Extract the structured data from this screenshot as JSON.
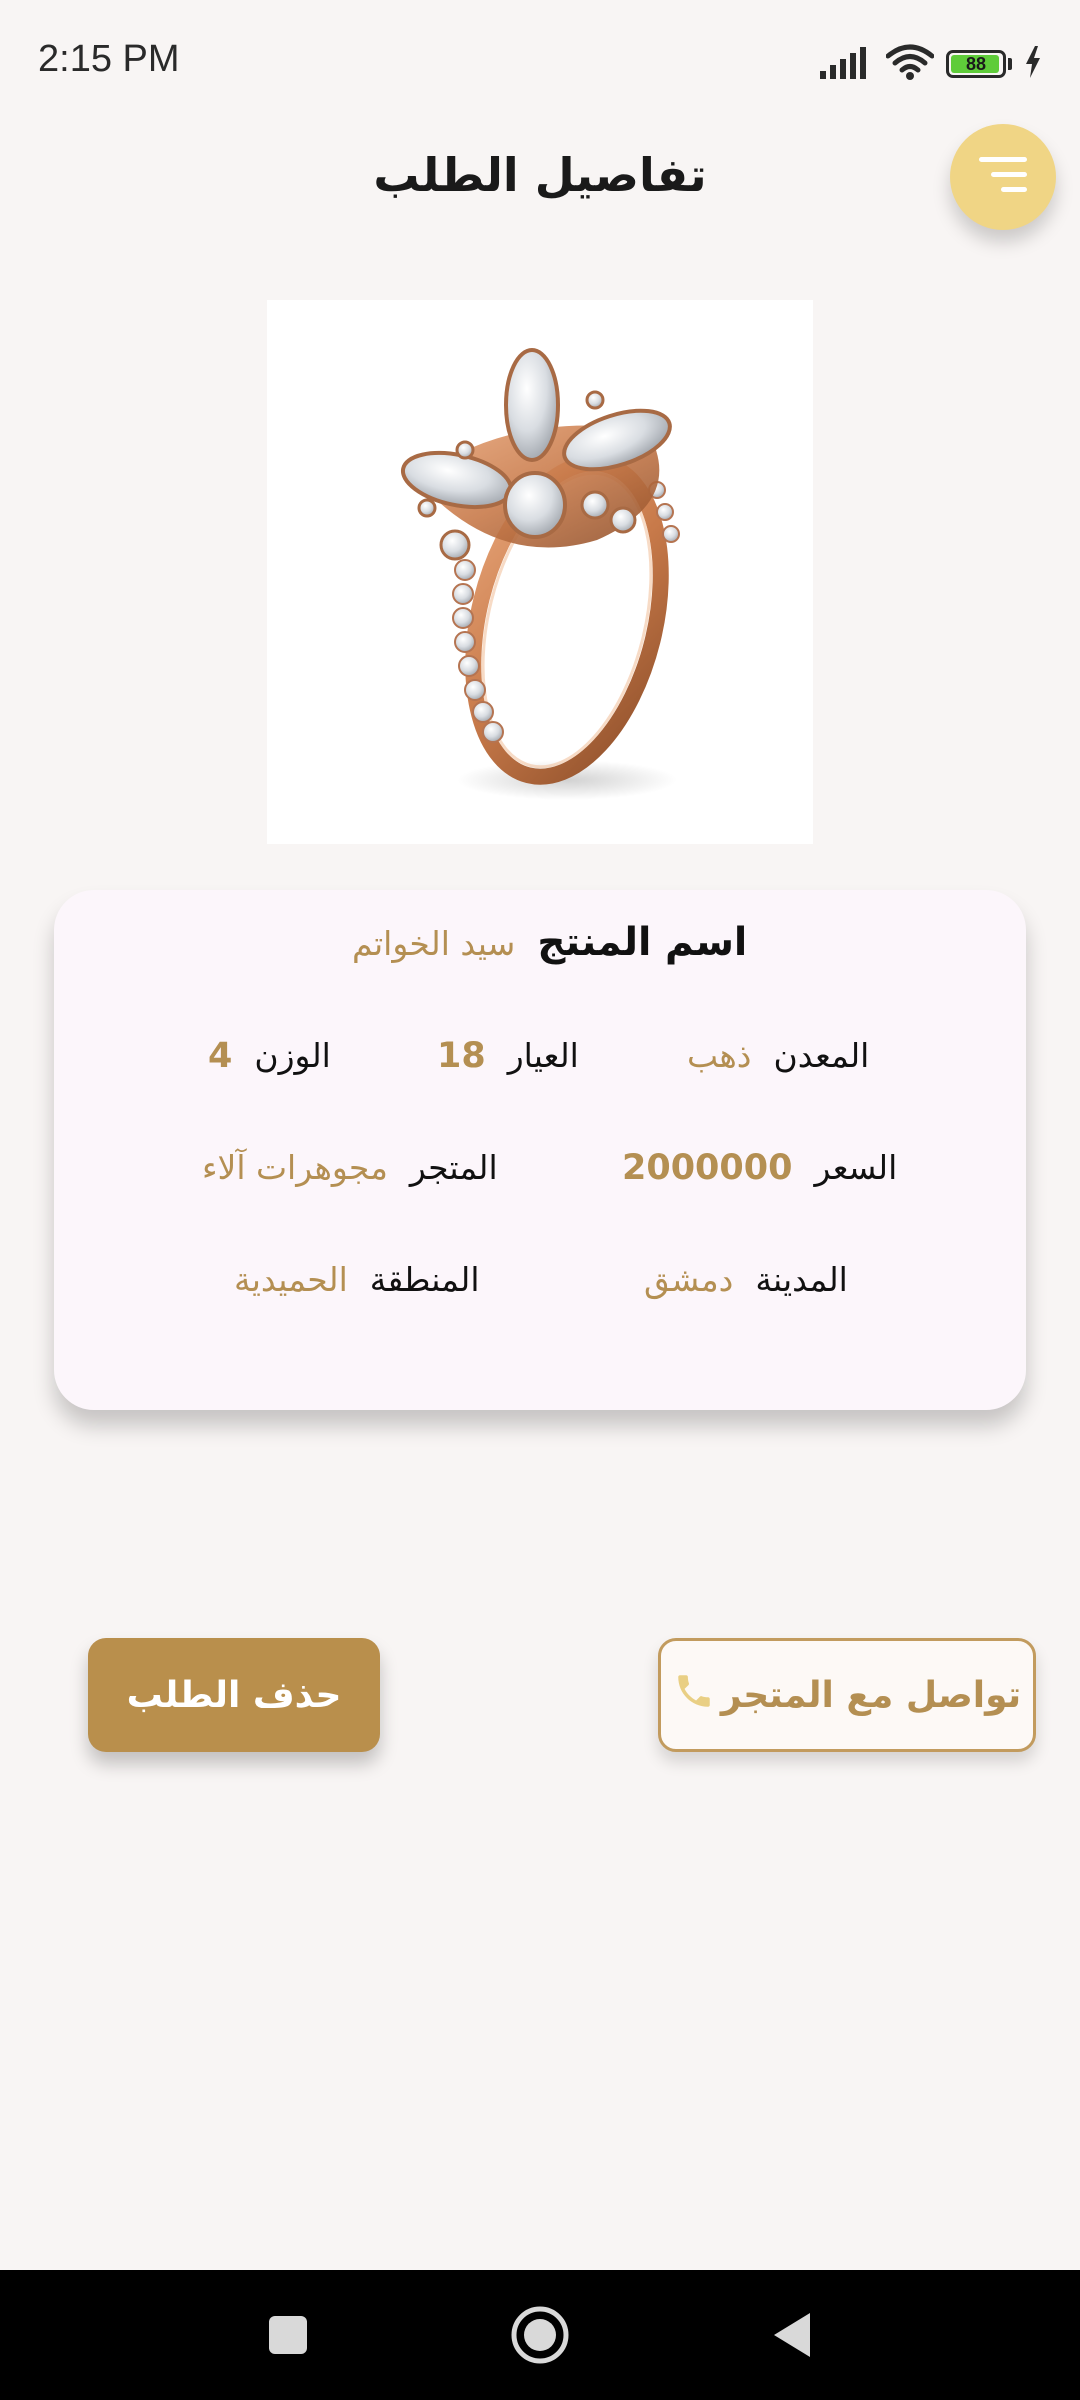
{
  "status_bar": {
    "time": "2:15 PM",
    "battery_level": "88",
    "icons": [
      "signal-icon",
      "wifi-icon",
      "battery-icon",
      "charging-icon"
    ]
  },
  "header": {
    "title": "تفاصيل الطلب",
    "menu_icon": "menu-lines-icon"
  },
  "product": {
    "image": "rose-gold-diamond-flower-ring"
  },
  "details": {
    "name": {
      "label": "اسم المنتج",
      "value": "سيد الخواتم"
    },
    "metal": {
      "label": "المعدن",
      "value": "ذهب"
    },
    "karat": {
      "label": "العيار",
      "value": "18"
    },
    "weight": {
      "label": "الوزن",
      "value": "4"
    },
    "price": {
      "label": "السعر",
      "value": "2000000"
    },
    "store": {
      "label": "المتجر",
      "value": "مجوهرات آلاء"
    },
    "city": {
      "label": "المدينة",
      "value": "دمشق"
    },
    "region": {
      "label": "المنطقة",
      "value": "الحميدية"
    }
  },
  "actions": {
    "delete_label": "حذف الطلب",
    "contact_label": "تواصل مع المتجر",
    "contact_icon": "phone-icon"
  },
  "colors": {
    "accent": "#b48f52",
    "button_fill": "#b98f4c",
    "fab": "#f0d585",
    "card": "#fcf6fb",
    "background": "#f8f5f4"
  },
  "nav_bar": {
    "buttons": [
      "recents-square-icon",
      "home-circle-icon",
      "back-triangle-icon"
    ]
  }
}
